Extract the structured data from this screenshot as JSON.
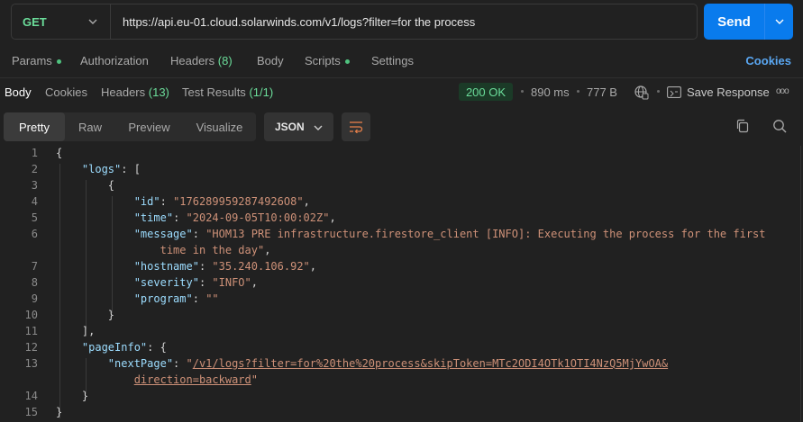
{
  "request": {
    "method": "GET",
    "url": "https://api.eu-01.cloud.solarwinds.com/v1/logs?filter=for the process",
    "send_label": "Send"
  },
  "request_tabs": [
    {
      "label": "Params",
      "dot": true
    },
    {
      "label": "Authorization"
    },
    {
      "label": "Headers",
      "count": "(8)"
    },
    {
      "label": "Body"
    },
    {
      "label": "Scripts",
      "dot": true
    },
    {
      "label": "Settings"
    }
  ],
  "cookies_link": "Cookies",
  "response": {
    "tabs": [
      {
        "label": "Body"
      },
      {
        "label": "Cookies"
      },
      {
        "label": "Headers",
        "count": "(13)"
      },
      {
        "label": "Test Results",
        "count": "(1/1)"
      }
    ],
    "status": "200 OK",
    "time": "890 ms",
    "size": "777 B",
    "save_label": "Save Response",
    "more": "ooo"
  },
  "view": {
    "modes": [
      "Pretty",
      "Raw",
      "Preview",
      "Visualize"
    ],
    "active_mode": "Pretty",
    "format": "JSON"
  },
  "code_lines": [
    {
      "n": "1",
      "t": "{"
    },
    {
      "n": "2",
      "t": "    \"logs\": ["
    },
    {
      "n": "3",
      "t": "        {"
    },
    {
      "n": "4",
      "t": "            \"id\": \"1762899592874926O8\","
    },
    {
      "n": "5",
      "t": "            \"time\": \"2024-09-05T10:00:02Z\","
    },
    {
      "n": "6",
      "t": "            \"message\": \"HOM13 PRE infrastructure.firestore_client [INFO]: Executing the process for the first"
    },
    {
      "n": "",
      "t": "                time in the day\","
    },
    {
      "n": "7",
      "t": "            \"hostname\": \"35.240.106.92\","
    },
    {
      "n": "8",
      "t": "            \"severity\": \"INFO\","
    },
    {
      "n": "9",
      "t": "            \"program\": \"\""
    },
    {
      "n": "10",
      "t": "        }"
    },
    {
      "n": "11",
      "t": "    ],"
    },
    {
      "n": "12",
      "t": "    \"pageInfo\": {"
    },
    {
      "n": "13",
      "t": "        \"nextPage\": \"/v1/logs?filter=for%20the%20process&skipToken=MTc2ODI4OTk1OTI4NzQ5MjYwOA&"
    },
    {
      "n": "",
      "t": "            direction=backward\""
    },
    {
      "n": "14",
      "t": "    }"
    },
    {
      "n": "15",
      "t": "}"
    }
  ]
}
